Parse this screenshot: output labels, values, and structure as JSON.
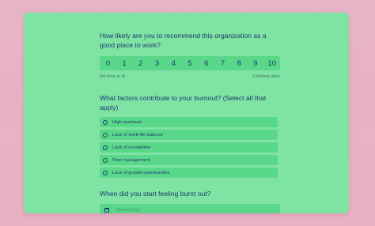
{
  "survey": {
    "q1": {
      "title": "How likely are you to recommend this organization as a good place to work?",
      "scale": [
        "0",
        "1",
        "2",
        "3",
        "4",
        "5",
        "6",
        "7",
        "8",
        "9",
        "10"
      ],
      "low_label": "Not likely at all",
      "high_label": "Extremely likely"
    },
    "q2": {
      "title": "What factors contribute to your burnout? (Select all that apply)",
      "options": [
        {
          "label": "High workload"
        },
        {
          "label": "Lack of work-life balance"
        },
        {
          "label": "Lack of recognition"
        },
        {
          "label": "Poor management"
        },
        {
          "label": "Lack of growth opportunities"
        }
      ]
    },
    "q3": {
      "title": "When did you start feeling burnt out?",
      "placeholder": "dd/mm/yyyy",
      "icon": "calendar-icon"
    }
  },
  "colors": {
    "page_background": "#e9b2c6",
    "card": "#7fe3a4",
    "field": "#5ad88a",
    "text": "#1d3a6e"
  }
}
